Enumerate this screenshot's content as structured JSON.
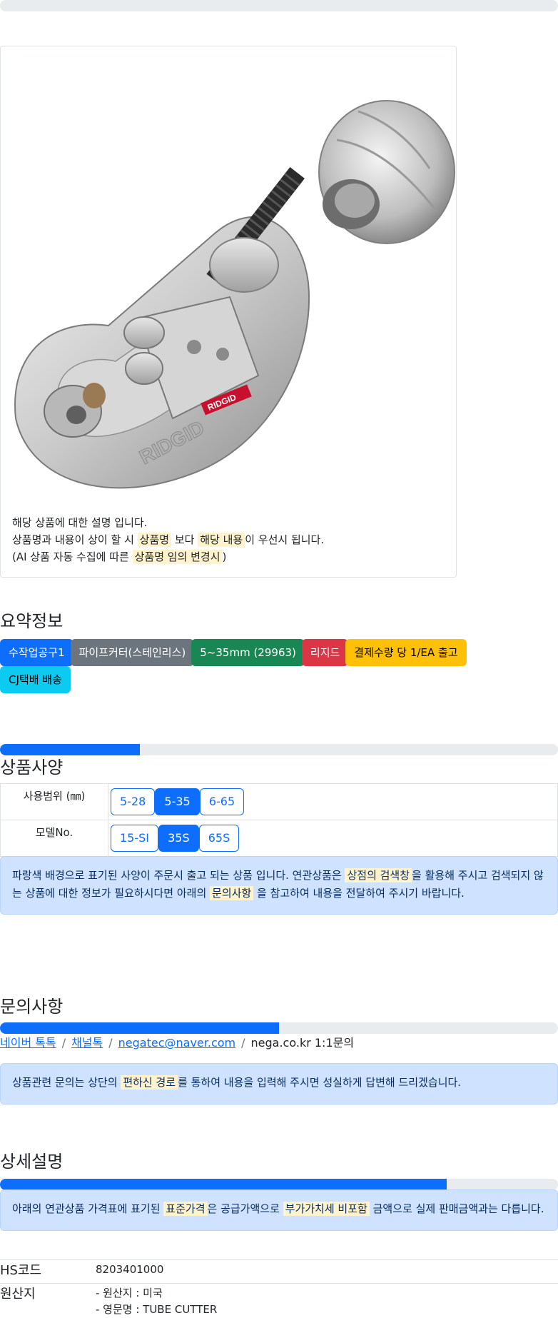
{
  "card": {
    "line1": "해당 상품에 대한 설명 입니다.",
    "line2_a": "상품명과 내용이 상이 할 시",
    "line2_hl1": "상품명",
    "line2_b": "보다",
    "line2_hl2": "해당 내용",
    "line2_c": "이 우선시 됩니다.",
    "line3_a": "(AI 상품 자동 수집에 따른",
    "line3_hl": "상품명 임의 변경시",
    "line3_b": ")"
  },
  "summary": {
    "title": "요약정보",
    "tags": [
      "수작업공구1",
      "파이프커터(스테인리스)",
      "5~35mm (29963)",
      "리지드",
      "결제수량 당 1/EA 출고",
      "CJ택배 배송"
    ]
  },
  "spec": {
    "title": "상품사양",
    "progress": 0.25,
    "rows": [
      {
        "label": "사용범위 (㎜)",
        "options": [
          "5-28",
          "5-35",
          "6-65"
        ],
        "active": 1
      },
      {
        "label": "모델No.",
        "options": [
          "15-SI",
          "35S",
          "65S"
        ],
        "active": 1
      }
    ],
    "notice_a": "파랑색 배경으로 표기된 사양이 주문시 출고 되는 상품 입니다. 연관상품은",
    "notice_hl1": "상점의 검색창",
    "notice_b": "을 활용해 주시고 검색되지 않는 상품에 대한 정보가 필요하시다면 아래의",
    "notice_hl2": "문의사항",
    "notice_c": "을 참고하여 내용을 전달하여 주시기 바랍니다."
  },
  "inquiry": {
    "title": "문의사항",
    "progress": 0.5,
    "links": [
      "네이버 톡톡",
      "채널톡",
      "negatec@naver.com"
    ],
    "plain": "nega.co.kr 1:1문의",
    "notice_a": "상품관련 문의는 상단의",
    "notice_hl": "편하신 경로",
    "notice_b": "를 통하여 내용을 입력해 주시면 성실하게 답변해 드리겠습니다."
  },
  "detail": {
    "title": "상세설명",
    "progress": 0.8,
    "notice_a": "아래의 연관상품 가격표에 표기된",
    "notice_hl1": "표준가격",
    "notice_b": "은 공급가액으로",
    "notice_hl2": "부가가치세 비포함",
    "notice_c": "금액으로 실제 판매금액과는 다릅니다."
  },
  "info": {
    "hs_label": "HS코드",
    "hs_value": "8203401000",
    "origin_label": "원산지",
    "origin_line1": "- 원산지 : 미국",
    "origin_line2": "- 영문명 : TUBE CUTTER"
  },
  "colors": {
    "primary": "#0d6efd",
    "secondary": "#6c757d",
    "success": "#198754",
    "danger": "#dc3545",
    "warning": "#ffc107",
    "info": "#0dcaf0",
    "highlight": "#fff3cd",
    "alert_bg": "#cfe2ff"
  }
}
